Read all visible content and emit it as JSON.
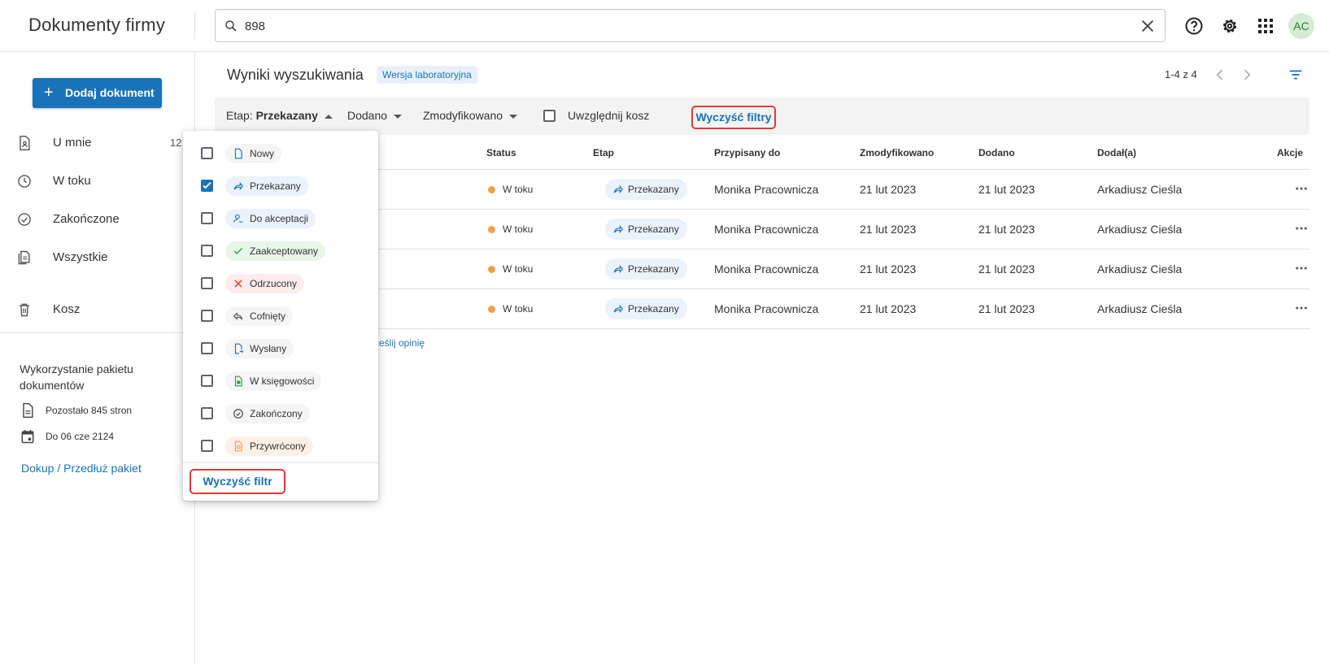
{
  "app": {
    "title": "Dokumenty firmy",
    "avatar": "AC"
  },
  "search": {
    "value": "898",
    "placeholder": ""
  },
  "sidebar": {
    "add_button": "Dodaj dokument",
    "items": [
      {
        "label": "U mnie",
        "count": "12",
        "icon": "doc-person-icon"
      },
      {
        "label": "W toku",
        "icon": "clock-icon"
      },
      {
        "label": "Zakończone",
        "icon": "check-circle-icon"
      },
      {
        "label": "Wszystkie",
        "icon": "docs-icon"
      },
      {
        "label": "Kosz",
        "icon": "trash-icon"
      }
    ],
    "usage": {
      "title": "Wykorzystanie pakietu dokumentów",
      "remaining": "Pozostało 845 stron",
      "until": "Do 06 cze 2124",
      "link": "Dokup / Przedłuż pakiet"
    }
  },
  "main": {
    "title": "Wyniki wyszukiwania",
    "badge": "Wersja laboratoryjna",
    "pager": "1-4 z 4",
    "filters": {
      "stage_prefix": "Etap:",
      "stage_value": "Przekazany",
      "added": "Dodano",
      "modified": "Zmodyfikowano",
      "trash": "Uwzględnij kosz",
      "clear": "Wyczyść filtry"
    },
    "columns": [
      "Status",
      "Etap",
      "Przypisany do",
      "Zmodyfikowano",
      "Dodano",
      "Dodał(a)",
      "Akcje"
    ],
    "rows": [
      {
        "status": "W toku",
        "stage": "Przekazany",
        "assignee": "Monika Pracownicza",
        "modified": "21 lut 2023",
        "added": "21 lut 2023",
        "by": "Arkadiusz Cieśla"
      },
      {
        "status": "W toku",
        "stage": "Przekazany",
        "assignee": "Monika Pracownicza",
        "modified": "21 lut 2023",
        "added": "21 lut 2023",
        "by": "Arkadiusz Cieśla"
      },
      {
        "status": "W toku",
        "stage": "Przekazany",
        "assignee": "Monika Pracownicza",
        "modified": "21 lut 2023",
        "added": "21 lut 2023",
        "by": "Arkadiusz Cieśla"
      },
      {
        "status": "W toku",
        "stage": "Przekazany",
        "assignee": "Monika Pracownicza",
        "modified": "21 lut 2023",
        "added": "21 lut 2023",
        "by": "Arkadiusz Cieśla"
      }
    ],
    "feedback": "ześlij opinię"
  },
  "stage_dropdown": {
    "options": [
      {
        "label": "Nowy",
        "checked": false,
        "icon": "new-doc-icon",
        "color": "#f5f5f5"
      },
      {
        "label": "Przekazany",
        "checked": true,
        "icon": "forward-icon",
        "color": "#eaf2fb"
      },
      {
        "label": "Do akceptacji",
        "checked": false,
        "icon": "person-pending-icon",
        "color": "#eaf2fb"
      },
      {
        "label": "Zaakceptowany",
        "checked": false,
        "icon": "check-icon",
        "color": "#e8f5e9"
      },
      {
        "label": "Odrzucony",
        "checked": false,
        "icon": "close-icon",
        "color": "#fdecec"
      },
      {
        "label": "Cofnięty",
        "checked": false,
        "icon": "undo-icon",
        "color": "#f5f5f5"
      },
      {
        "label": "Wysłany",
        "checked": false,
        "icon": "sent-doc-icon",
        "color": "#f5f5f5"
      },
      {
        "label": "W księgowości",
        "checked": false,
        "icon": "accounting-doc-icon",
        "color": "#f5f5f5"
      },
      {
        "label": "Zakończony",
        "checked": false,
        "icon": "check-circle-icon",
        "color": "#f5f5f5"
      },
      {
        "label": "Przywrócony",
        "checked": false,
        "icon": "restore-doc-icon",
        "color": "#fdf0e6"
      }
    ],
    "clear": "Wyczyść filtr"
  },
  "colors": {
    "accent": "#1a73b8",
    "status_dot": "#f0a04b",
    "highlight": "#e53935"
  }
}
